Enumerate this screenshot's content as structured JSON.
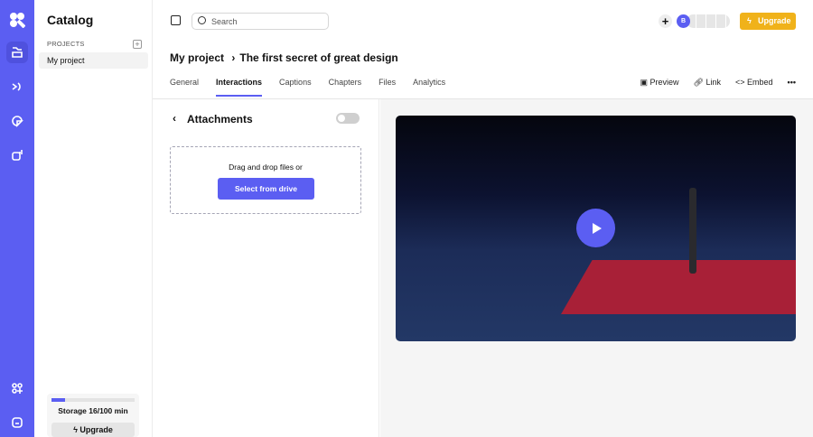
{
  "sidebar": {
    "title": "Catalog",
    "section": "PROJECTS",
    "items": [
      {
        "label": "My project"
      }
    ],
    "storage": {
      "label": "Storage 16/100 min",
      "used": 16,
      "total": 100
    },
    "upgrade": "Upgrade"
  },
  "header": {
    "search_placeholder": "Search",
    "avatar": "B",
    "upgrade": "Upgrade"
  },
  "breadcrumb": {
    "project": "My project",
    "separator": "›",
    "page": "The first secret of great design"
  },
  "tabs": [
    "General",
    "Interactions",
    "Captions",
    "Chapters",
    "Files",
    "Analytics"
  ],
  "actions": {
    "preview": "Preview",
    "link": "Link",
    "embed": "Embed"
  },
  "panel": {
    "title": "Attachments",
    "drop_text": "Drag and drop files or",
    "select_button": "Select from drive",
    "toggle_on": false
  },
  "colors": {
    "accent": "#5b5ef2",
    "upgrade": "#f0b21a"
  }
}
